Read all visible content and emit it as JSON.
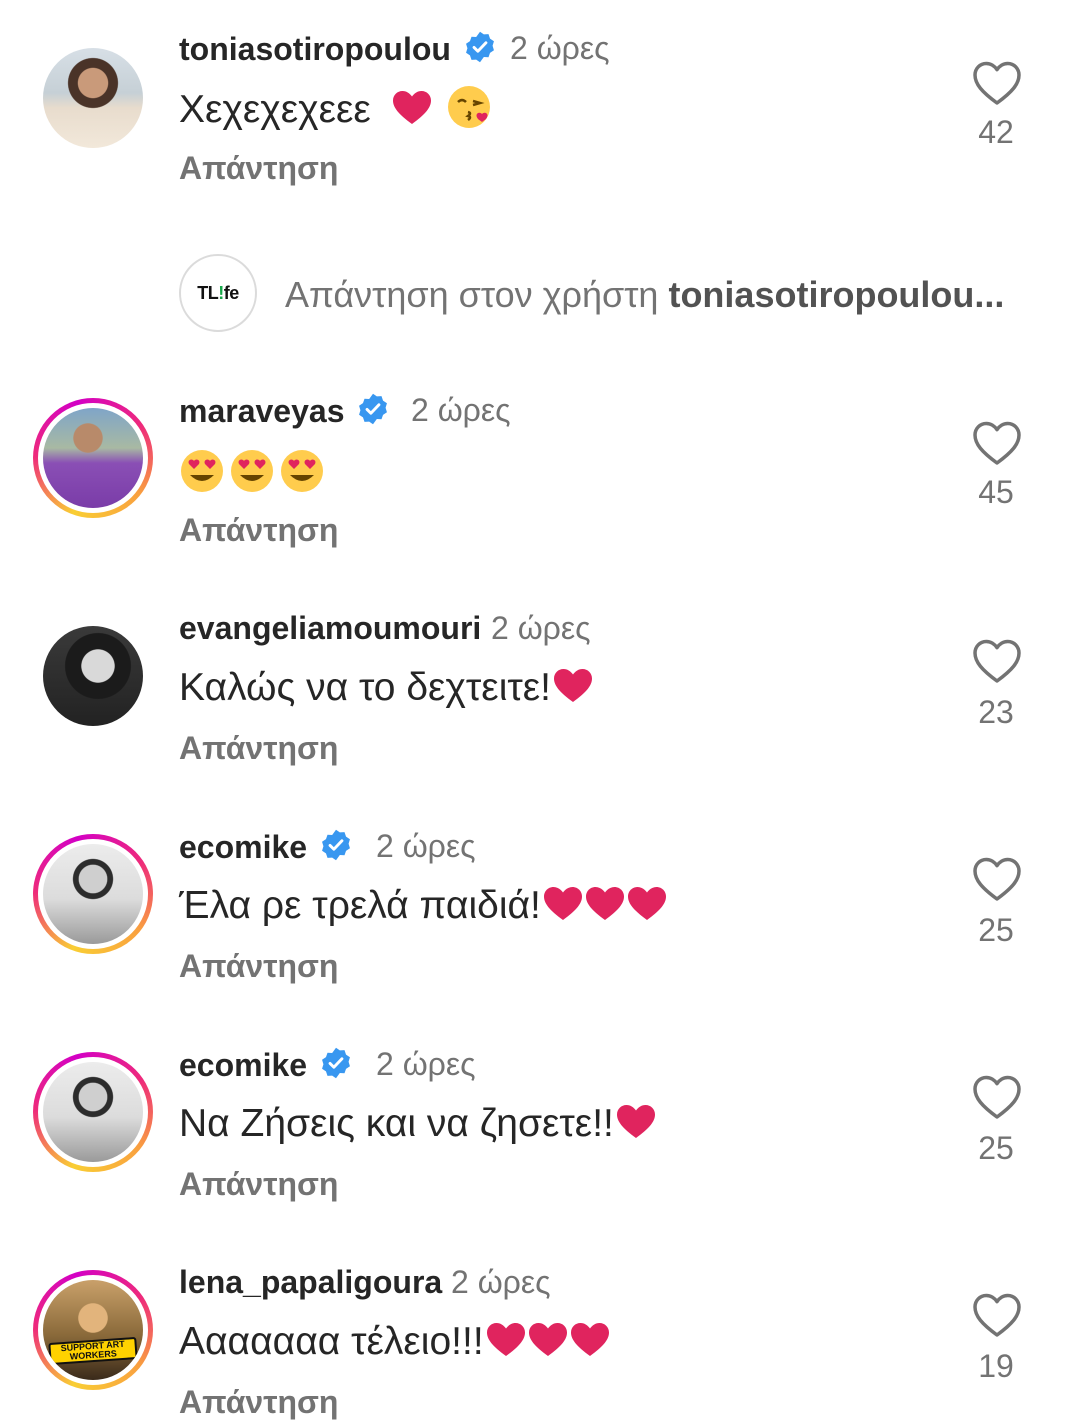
{
  "thread_reply": {
    "prefix": "Απάντηση στον χρήστη ",
    "user": "toniasotiropoulou...",
    "avatar_logo": {
      "part1": "TL",
      "part2": "!",
      "part3": "fe"
    }
  },
  "reply_label": "Απάντηση",
  "colors": {
    "verified": "#3897f0",
    "heart": "#e0245e",
    "muted": "#737373",
    "text": "#262626"
  },
  "comments": [
    {
      "username": "toniasotiropoulou",
      "verified": true,
      "time": "2 ώρες",
      "text": "Χεχεχεχεεε",
      "emojis": [
        "red-heart",
        "face-blowing-kiss"
      ],
      "likes": "42",
      "reply": "Απάντηση"
    },
    {
      "username": "maraveyas",
      "verified": true,
      "time": "2 ώρες",
      "text": "",
      "emojis": [
        "heart-eyes",
        "heart-eyes",
        "heart-eyes"
      ],
      "likes": "45",
      "reply": "Απάντηση"
    },
    {
      "username": "evangeliamoumouri",
      "verified": false,
      "time": "2 ώρες",
      "text": "Καλώς να το δεχτειτε!",
      "emojis": [
        "red-heart"
      ],
      "likes": "23",
      "reply": "Απάντηση"
    },
    {
      "username": "ecomike",
      "verified": true,
      "time": "2 ώρες",
      "text": "Έλα ρε τρελά παιδιά!",
      "emojis": [
        "red-heart",
        "red-heart",
        "red-heart"
      ],
      "likes": "25",
      "reply": "Απάντηση"
    },
    {
      "username": "ecomike",
      "verified": true,
      "time": "2 ώρες",
      "text": "Να Ζήσεις και να ζησετε!!",
      "emojis": [
        "red-heart"
      ],
      "likes": "25",
      "reply": "Απάντηση"
    },
    {
      "username": "lena_papaligoura",
      "verified": false,
      "time": "2 ώρες",
      "text": "Ααααααα τέλειο!!!",
      "emojis": [
        "red-heart",
        "red-heart",
        "red-heart"
      ],
      "likes": "19",
      "reply": "Απάντηση",
      "avatar_badge": [
        "SUPPORT ART",
        "WORKERS"
      ]
    }
  ]
}
